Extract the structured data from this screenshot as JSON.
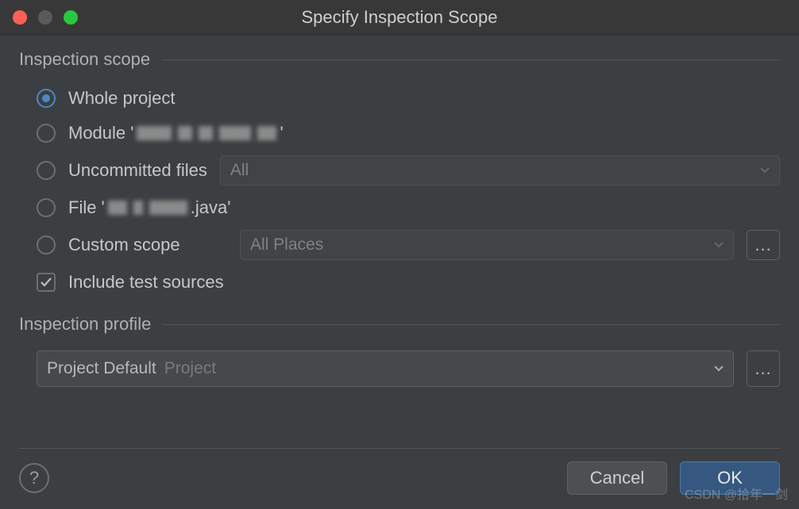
{
  "title": "Specify Inspection Scope",
  "scope": {
    "legend": "Inspection scope",
    "whole_project": "Whole project",
    "module_prefix": "Module '",
    "module_suffix": "'",
    "uncommitted": "Uncommitted files",
    "uncommitted_value": "All",
    "file_prefix": "File '",
    "file_suffix": ".java'",
    "custom": "Custom scope",
    "custom_value": "All Places",
    "include_tests": "Include test sources",
    "ellipsis": "..."
  },
  "profile": {
    "legend": "Inspection profile",
    "value": "Project Default",
    "hint": "Project",
    "ellipsis": "..."
  },
  "buttons": {
    "help": "?",
    "cancel": "Cancel",
    "ok": "OK"
  },
  "watermark": "CSDN @拾年一剑"
}
